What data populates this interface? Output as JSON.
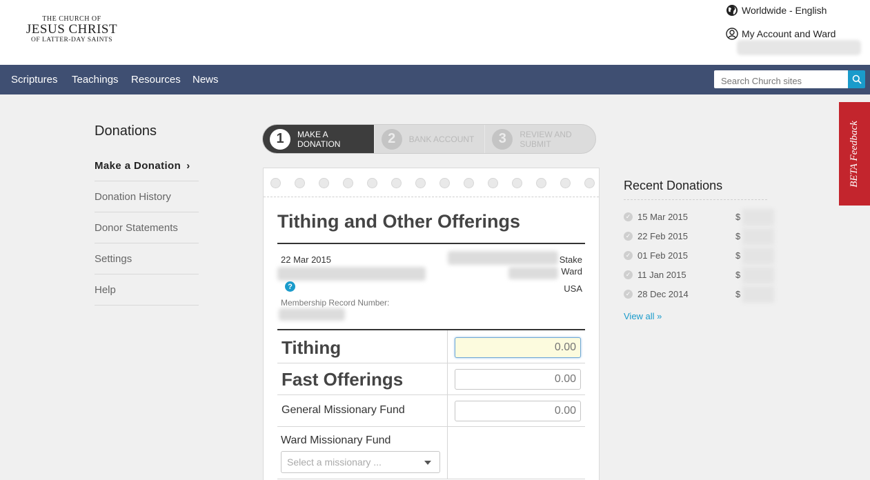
{
  "logo": {
    "line1": "THE CHURCH OF",
    "line2": "JESUS CHRIST",
    "line3": "OF LATTER-DAY SAINTS"
  },
  "utility": {
    "language": "Worldwide - English",
    "account": "My Account and Ward"
  },
  "nav": {
    "items": [
      "Scriptures",
      "Teachings",
      "Resources",
      "News"
    ],
    "search_placeholder": "Search Church sites"
  },
  "sidebar": {
    "title": "Donations",
    "items": [
      {
        "label": "Make a Donation",
        "active": true
      },
      {
        "label": "Donation History"
      },
      {
        "label": "Donor Statements"
      },
      {
        "label": "Settings"
      },
      {
        "label": "Help"
      }
    ]
  },
  "steps": [
    {
      "num": "1",
      "label": "Make a Donation",
      "state": "active"
    },
    {
      "num": "2",
      "label": "Bank Account",
      "state": "inactive"
    },
    {
      "num": "3",
      "label": "Review and Submit",
      "state": "inactive"
    }
  ],
  "form": {
    "title": "Tithing and Other Offerings",
    "date": "22 Mar 2015",
    "stake_label": "Stake",
    "ward_label": "Ward",
    "country": "USA",
    "membership_label": "Membership Record Number:",
    "funds": [
      {
        "name": "Tithing",
        "placeholder": "0.00"
      },
      {
        "name": "Fast Offerings",
        "placeholder": "0.00"
      },
      {
        "name": "General Missionary Fund",
        "placeholder": "0.00"
      }
    ],
    "ward_missionary": {
      "name": "Ward Missionary Fund",
      "select_placeholder": "Select a missionary ..."
    }
  },
  "recent": {
    "title": "Recent Donations",
    "items": [
      {
        "date": "15 Mar 2015",
        "currency": "$"
      },
      {
        "date": "22 Feb 2015",
        "currency": "$"
      },
      {
        "date": "01 Feb 2015",
        "currency": "$"
      },
      {
        "date": "11 Jan 2015",
        "currency": "$"
      },
      {
        "date": "28 Dec 2014",
        "currency": "$"
      }
    ],
    "view_all": "View all »"
  },
  "beta": "BETA Feedback",
  "colors": {
    "nav": "#3f4f72",
    "accent": "#1a9bcb",
    "beta": "#c3252d",
    "step_active": "#3d3d3d"
  }
}
